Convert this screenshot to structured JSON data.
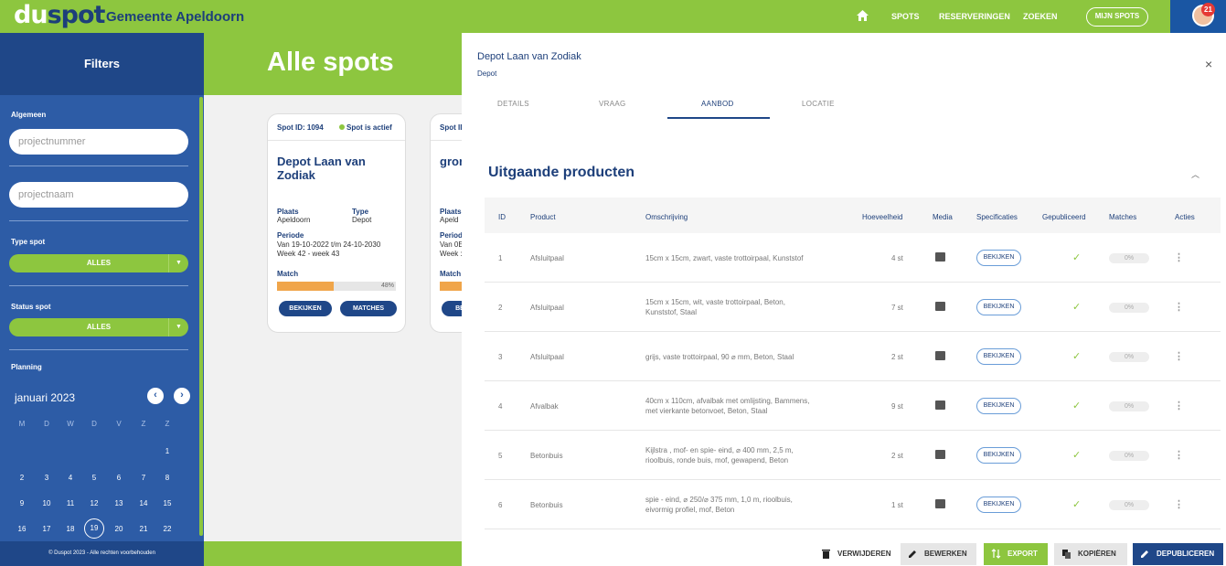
{
  "header": {
    "logo_du": "du",
    "logo_spot": "spot",
    "municipality": "Gemeente Apeldoorn",
    "nav": [
      "SPOTS",
      "RESERVERINGEN",
      "ZOEKEN"
    ],
    "my_spots": "MIJN SPOTS",
    "notifications": "21"
  },
  "sidebar": {
    "title": "Filters",
    "general_label": "Algemeen",
    "project_number_placeholder": "projectnummer",
    "project_name_placeholder": "projectnaam",
    "type_label": "Type spot",
    "type_value": "ALLES",
    "status_label": "Status spot",
    "status_value": "ALLES",
    "planning_label": "Planning",
    "calendar": {
      "month": "januari 2023",
      "weekdays": [
        "M",
        "D",
        "W",
        "D",
        "V",
        "Z",
        "Z"
      ],
      "weeks": [
        [
          "",
          "",
          "",
          "",
          "",
          "",
          "1"
        ],
        [
          "2",
          "3",
          "4",
          "5",
          "6",
          "7",
          "8"
        ],
        [
          "9",
          "10",
          "11",
          "12",
          "13",
          "14",
          "15"
        ],
        [
          "16",
          "17",
          "18",
          "19",
          "20",
          "21",
          "22"
        ]
      ],
      "today": "19"
    },
    "footer": "© Duspot 2023 - Alle rechten voorbehouden"
  },
  "main": {
    "title": "Alle spots",
    "card": {
      "spot_id": "Spot ID: 1094",
      "status": "Spot is actief",
      "name": "Depot Laan van Zodiak",
      "place_label": "Plaats",
      "place": "Apeldoorn",
      "type_label": "Type",
      "type": "Depot",
      "period_label": "Periode",
      "period": "Van 19-10-2022 t/m 24-10-2030",
      "weeks": "Week 42 - week 43",
      "match_label": "Match",
      "match_pct": "48%",
      "match_fraction": 0.48,
      "view_btn": "BEKIJKEN",
      "matches_btn": "MATCHES"
    },
    "card2": {
      "spot_id": "Spot ID",
      "name": "gron",
      "place_label": "Plaats",
      "place": "Apeld",
      "period_label": "Period",
      "period": "Van 0E",
      "weeks": "Week :",
      "match_label": "Match",
      "btn": "BE"
    }
  },
  "panel": {
    "title": "Depot Laan van Zodiak",
    "subtitle": "Depot",
    "close": "×",
    "tabs": [
      "DETAILS",
      "VRAAG",
      "AANBOD",
      "LOCATIE"
    ],
    "section_title": "Uitgaande producten",
    "columns": [
      "ID",
      "Product",
      "Omschrijving",
      "Hoeveelheid",
      "Media",
      "Specificaties",
      "Gepubliceerd",
      "Matches",
      "Acties"
    ],
    "rows": [
      {
        "id": "1",
        "product": "Afsluitpaal",
        "desc1": "15cm x 15cm, zwart, vaste trottoirpaal, Kunststof",
        "desc2": "",
        "qty": "4 st",
        "spec": "BEKIJKEN",
        "matches": "0%"
      },
      {
        "id": "2",
        "product": "Afsluitpaal",
        "desc1": "15cm x 15cm, wit, vaste trottoirpaal, Beton,",
        "desc2": "Kunststof, Staal",
        "qty": "7 st",
        "spec": "BEKIJKEN",
        "matches": "0%"
      },
      {
        "id": "3",
        "product": "Afsluitpaal",
        "desc1": "grijs, vaste trottoirpaal, 90 ⌀ mm, Beton, Staal",
        "desc2": "",
        "qty": "2 st",
        "spec": "BEKIJKEN",
        "matches": "0%"
      },
      {
        "id": "4",
        "product": "Afvalbak",
        "desc1": "40cm x 110cm, afvalbak met omlijsting, Bammens,",
        "desc2": "met vierkante betonvoet, Beton, Staal",
        "qty": "9 st",
        "spec": "BEKIJKEN",
        "matches": "0%"
      },
      {
        "id": "5",
        "product": "Betonbuis",
        "desc1": "Kijlstra , mof- en spie- eind, ⌀ 400 mm, 2,5 m,",
        "desc2": "rioolbuis, ronde buis, mof, gewapend, Beton",
        "qty": "2 st",
        "spec": "BEKIJKEN",
        "matches": "0%"
      },
      {
        "id": "6",
        "product": "Betonbuis",
        "desc1": "spie - eind, ⌀ 250/⌀ 375 mm, 1,0 m, rioolbuis,",
        "desc2": "eivormig profiel, mof, Beton",
        "qty": "1 st",
        "spec": "BEKIJKEN",
        "matches": "0%"
      }
    ],
    "actions": {
      "delete": "VERWIJDEREN",
      "edit": "BEWERKEN",
      "export": "EXPORT",
      "copy": "KOPIËREN",
      "unpublish": "DEPUBLICEREN"
    }
  },
  "colors": {
    "green": "#8dc63f",
    "blue": "#2d5ca6",
    "navy": "#1d3f7a"
  }
}
